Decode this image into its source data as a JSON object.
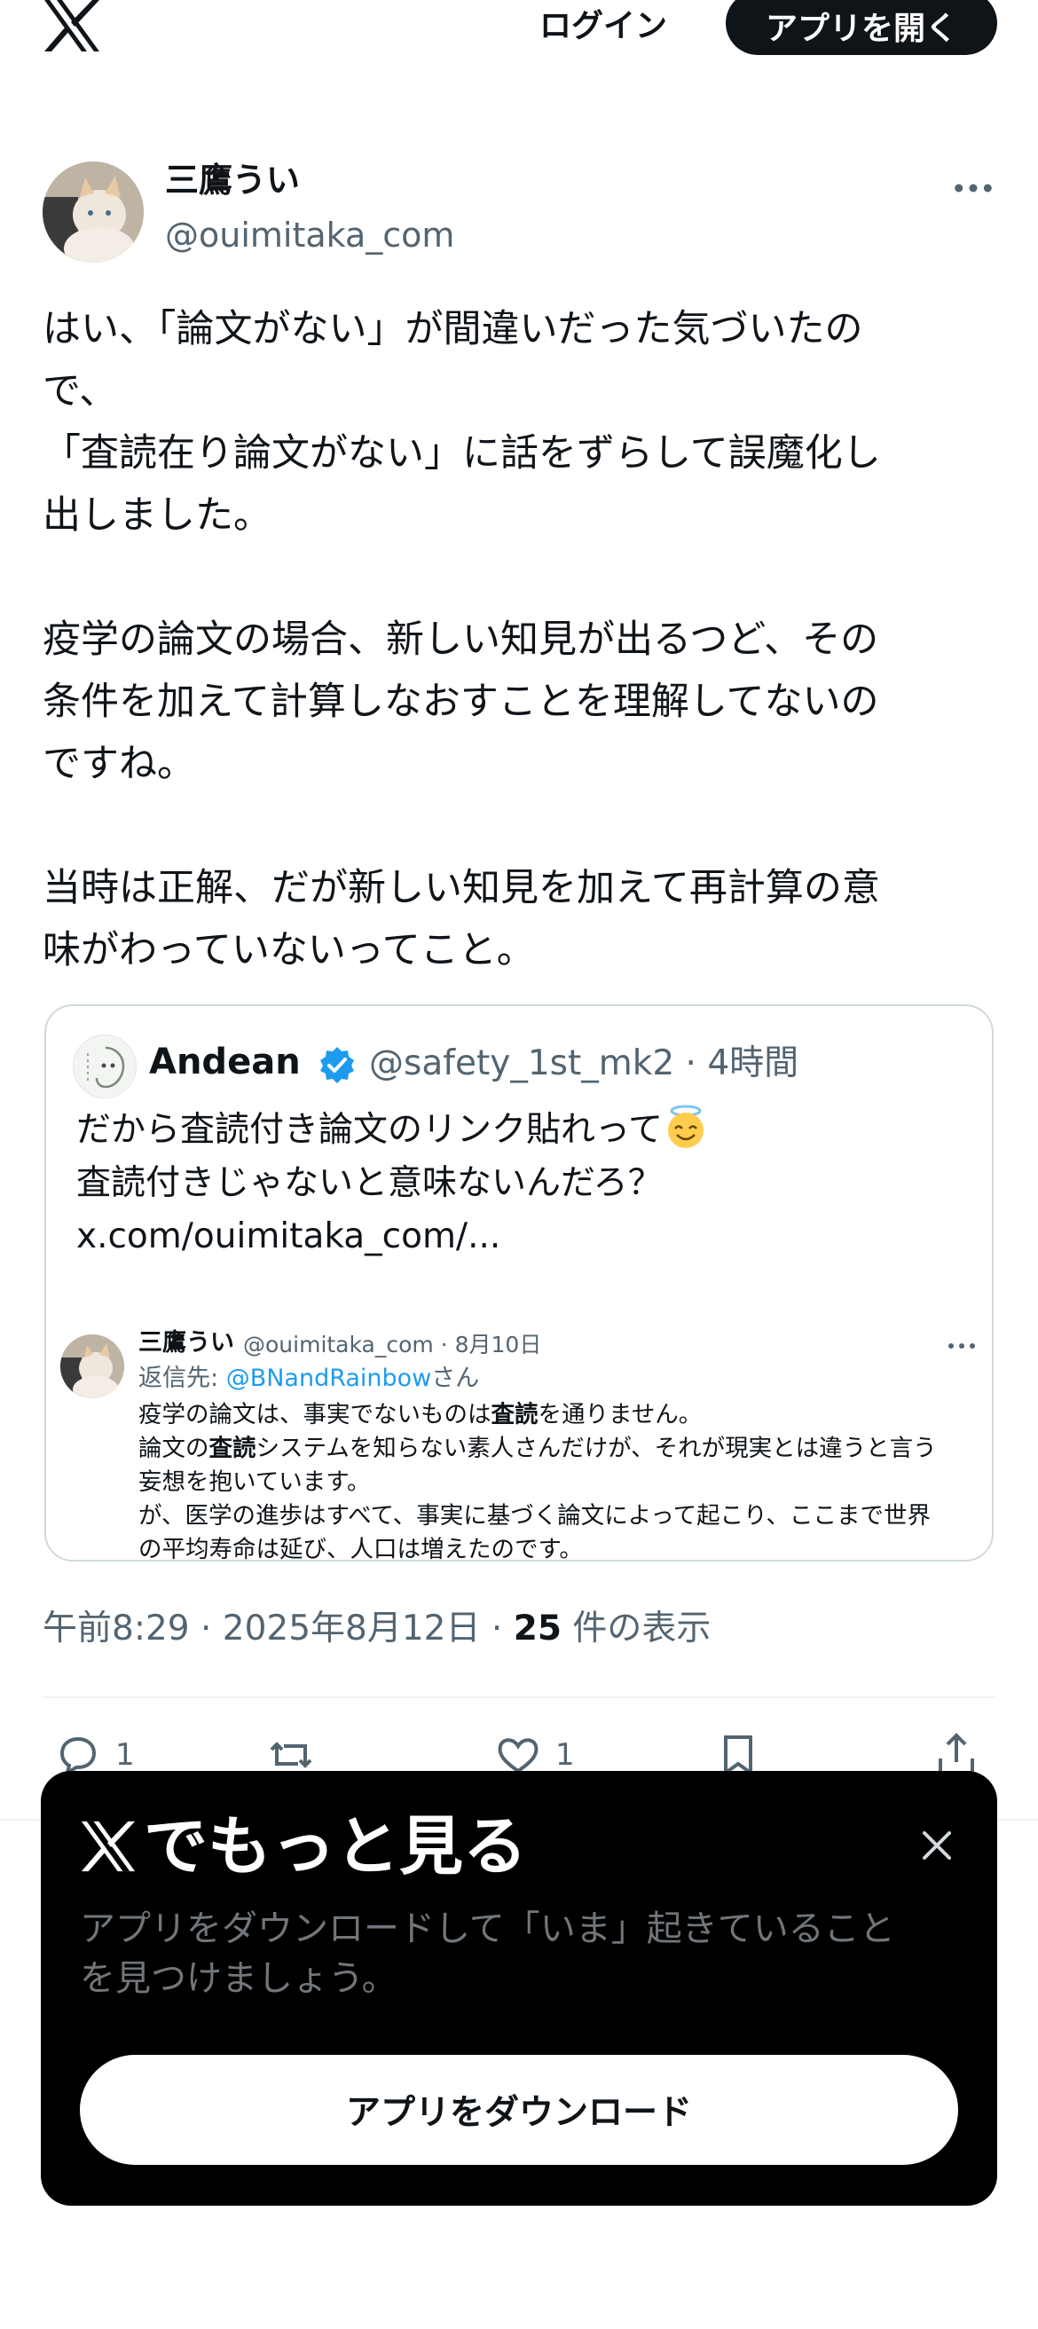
{
  "header": {
    "logo_icon": "x-logo-icon",
    "login_label": "ログイン",
    "open_app_label": "アプリを開く"
  },
  "post": {
    "author_name": "三鷹うい",
    "author_handle": "@ouimitaka_com",
    "text": "はい、「論文がない」が間違いだった気づいたの\nで、\n「査読在り論文がない」に話をずらして誤魔化し\n出しました。\n\n疫学の論文の場合、新しい知見が出るつど、その\n条件を加えて計算しなおすことを理解してないの\nですね。\n\n当時は正解、だが新しい知見を加えて再計算の意\n味がわっていないってこと。",
    "time": "午前8:29",
    "sep1": " · ",
    "date": "2025年8月12日",
    "sep2": " · ",
    "views_count": "25",
    "views_label": " 件の表示"
  },
  "quote": {
    "name": "Andean",
    "handle_time": "@safety_1st_mk2 · 4時間",
    "text_line1": "だから査読付き論文のリンク貼れって",
    "text_rest": "査読付きじゃないと意味ないんだろ？\nx.com/ouimitaka_com/...",
    "embedded": {
      "name": "三鷹うい",
      "meta": "@ouimitaka_com · 8月10日",
      "reply_prefix": "返信先: ",
      "reply_handle": "@BNandRainbow",
      "reply_suffix": "さん",
      "line1_a": "疫学の論文は、事実でないものは",
      "line1_b": "査読",
      "line1_c": "を通りません。",
      "line2_a": "論文の",
      "line2_b": "査読",
      "line2_c": "システムを知らない素人さんだけが、それが現実とは違うと言う",
      "line3": "妄想を抱いています。",
      "line4": "が、医学の進歩はすべて、事実に基づく論文によって起こり、ここまで世界",
      "line5": "の平均寿命は延び、人口は増えたのです。"
    }
  },
  "actions": {
    "reply_count": "1",
    "like_count": "1"
  },
  "sheet": {
    "title": "でもっと見る",
    "description": "アプリをダウンロードして「いま」起きていること\nを見つけましょう。",
    "button_label": "アプリをダウンロード"
  },
  "colors": {
    "text_primary": "#0f1419",
    "text_secondary": "#536471",
    "link": "#1d9bf0",
    "verified": "#1d9bf0",
    "sheet_bg": "#000000"
  }
}
